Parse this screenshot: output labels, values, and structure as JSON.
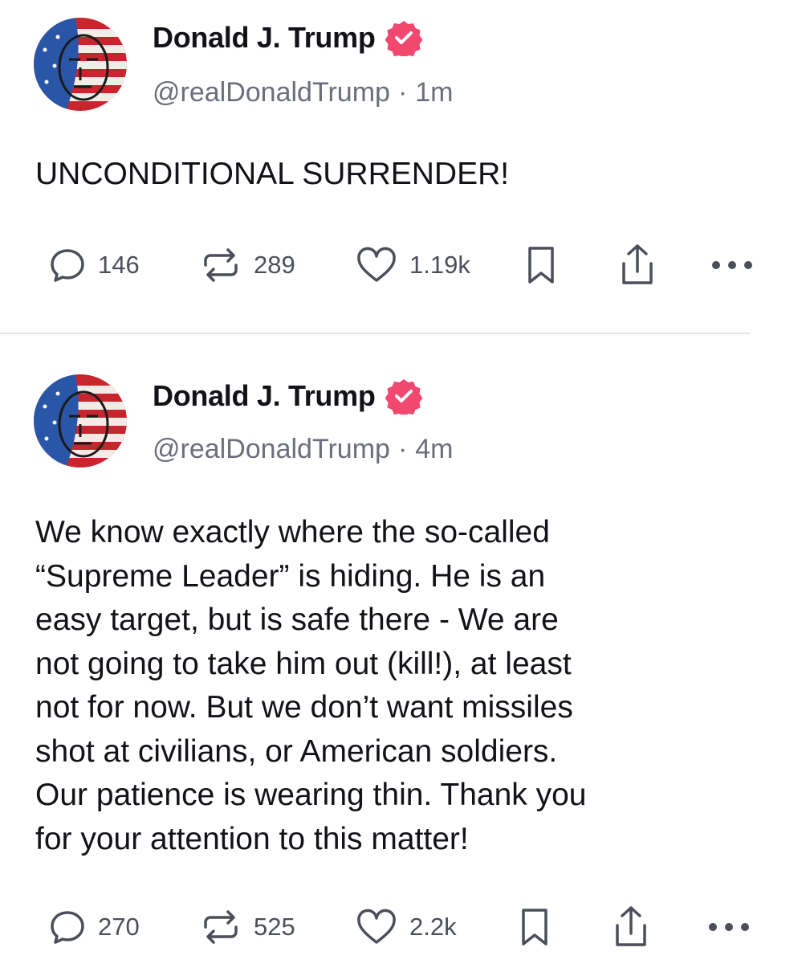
{
  "colors": {
    "verified_badge": "#f2476f",
    "text_primary": "#111318",
    "text_secondary": "#6b6f7b",
    "icon": "#4b4f5a",
    "divider": "#e4e5ea"
  },
  "posts": [
    {
      "author": {
        "display_name": "Donald J. Trump",
        "handle": "@realDonaldTrump",
        "verified": true,
        "avatar_icon": "flag-portrait-avatar"
      },
      "separator": "·",
      "time": "1m",
      "text": "UNCONDITIONAL SURRENDER!",
      "actions": {
        "replies": "146",
        "reposts": "289",
        "likes": "1.19k",
        "icons": [
          "reply-icon",
          "repost-icon",
          "heart-icon",
          "bookmark-icon",
          "share-icon",
          "more-icon"
        ]
      }
    },
    {
      "author": {
        "display_name": "Donald J. Trump",
        "handle": "@realDonaldTrump",
        "verified": true,
        "avatar_icon": "flag-portrait-avatar"
      },
      "separator": "·",
      "time": "4m",
      "text": "We know exactly where the so-called\n“Supreme Leader” is hiding. He is an\neasy target, but is safe there - We are\nnot going to take him out (kill!), at least\nnot for now. But we don’t want missiles\nshot at civilians, or American soldiers.\nOur patience is wearing thin. Thank you\nfor your attention to this matter!",
      "actions": {
        "replies": "270",
        "reposts": "525",
        "likes": "2.2k",
        "icons": [
          "reply-icon",
          "repost-icon",
          "heart-icon",
          "bookmark-icon",
          "share-icon",
          "more-icon"
        ]
      }
    }
  ]
}
